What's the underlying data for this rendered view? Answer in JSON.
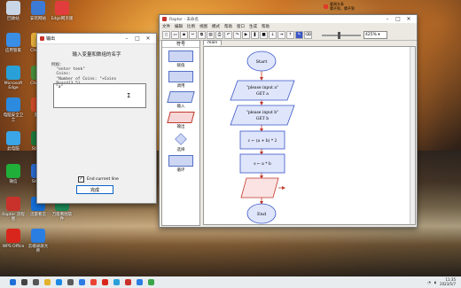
{
  "desktop": {
    "icons": [
      {
        "label": "回收站",
        "color": "#c9d6e8"
      },
      {
        "label": "安装网站",
        "color": "#3b7bd6"
      },
      {
        "label": "Edge网页版",
        "color": "#e23d3d"
      },
      {
        "label": "应用管家",
        "color": "#3a8ee6"
      },
      {
        "label": "Chrome",
        "color": "#e8b33b"
      },
      {
        "label": "Microsoft Edge",
        "color": "#2aa0d8"
      },
      {
        "label": "Chrome",
        "color": "#4a8f3c"
      },
      {
        "label": "电脑安全卫士",
        "color": "#2c8adf"
      },
      {
        "label": "黑客",
        "color": "#d24a2a"
      },
      {
        "label": "此电脑",
        "color": "#3aa6e8"
      },
      {
        "label": "Studio",
        "color": "#1e7a3c"
      },
      {
        "label": "微信",
        "color": "#20b03a"
      },
      {
        "label": "Studio",
        "color": "#2a6bd1"
      },
      {
        "label": "迅雷",
        "color": "#1b6de0"
      },
      {
        "label": "Raptor 流程图",
        "color": "#c8322a"
      },
      {
        "label": "迅雷看云",
        "color": "#1570d8"
      },
      {
        "label": "万能看图软件",
        "color": "#1c8d5a"
      },
      {
        "label": "WPS Office",
        "color": "#d9261c"
      },
      {
        "label": "云端录屏大师",
        "color": "#2a7de1"
      }
    ]
  },
  "dialog": {
    "title": "输出",
    "heading": "输入变量和数组的名字",
    "example_label": "例如：",
    "example_lines": [
      "\"enter tenk\"",
      "Coins:",
      "\"Number of Coins: \"+Coins",
      "Board[3,5]"
    ],
    "input_value": "\"a\"",
    "checkbox_label": "End current line",
    "checkbox_checked": true,
    "done_button": "完成"
  },
  "raptor": {
    "title": "Raptor - 未命名",
    "menu": [
      "文件",
      "编辑",
      "比例",
      "视图",
      "模式",
      "帮助",
      "窗口",
      "生成",
      "帮助"
    ],
    "toolbar_icons": [
      "new-file-icon",
      "open-icon",
      "save-icon",
      "cut-icon",
      "copy-icon",
      "paste-icon",
      "print-icon",
      "undo-icon",
      "redo-icon",
      "play-icon",
      "pause-icon",
      "stop-icon",
      "step-icon",
      "run-to-icon",
      "step-back-icon",
      "pen-icon",
      "clear-icon"
    ],
    "zoom": "425%",
    "symbols_header": "符号",
    "symbols": [
      "赋值",
      "调用",
      "输入",
      "输出",
      "选择",
      "循环"
    ],
    "tab": "main",
    "flowchart": {
      "start": "Start",
      "input_a": [
        "\"please input a\"",
        "GET a"
      ],
      "input_b": [
        "\"please input b\"",
        "GET b"
      ],
      "assign_c": "c ← (a + b) * 2",
      "assign_s": "s ← a * b",
      "output": "",
      "end": "End"
    }
  },
  "taskbar": {
    "icons": [
      "windows-icon",
      "search-icon",
      "task-view-icon",
      "file-explorer-icon",
      "edge-icon",
      "store-icon",
      "mail-icon",
      "chrome-icon",
      "wps-icon",
      "app-icon",
      "raptor-icon",
      "app2-icon",
      "app3-icon"
    ],
    "news_title": "要闻头条",
    "news_sub": "猜不到，猜不到",
    "time": "11:35",
    "date": "2023/5/7"
  }
}
